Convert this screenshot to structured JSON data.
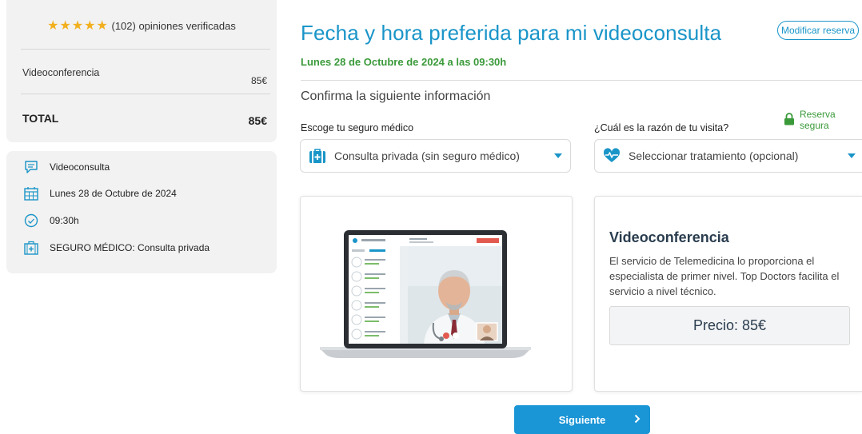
{
  "summary": {
    "rating_stars": "★★★★★",
    "rating_text": "(102) opiniones verificadas",
    "line_item_label": "Videoconferencia",
    "line_item_price": "85€",
    "total_label": "TOTAL",
    "total_price": "85€"
  },
  "details": {
    "items": [
      {
        "icon": "chat-icon",
        "label": "Videoconsulta"
      },
      {
        "icon": "calendar-icon",
        "label": "Lunes 28 de Octubre de 2024"
      },
      {
        "icon": "clock-icon",
        "label": "09:30h"
      },
      {
        "icon": "medical-case-icon",
        "label": "SEGURO MÉDICO: Consulta privada"
      }
    ]
  },
  "header": {
    "title": "Fecha y hora preferida para mi videoconsulta",
    "modify_label": "Modificar reserva",
    "selected_date": "Lunes 28 de Octubre de 2024 a las 09:30h"
  },
  "form": {
    "confirm_title": "Confirma la siguiente información",
    "secure_label": "Reserva segura",
    "insurance_label": "Escoge tu seguro médico",
    "insurance_value": "Consulta privada (sin seguro médico)",
    "reason_label": "¿Cuál es la razón de tu visita?",
    "reason_value": "Seleccionar tratamiento (opcional)"
  },
  "info_panel": {
    "title": "Videoconferencia",
    "description": "El servicio de Telemedicina lo proporciona el especialista de primer nivel. Top Doctors facilita el servicio a nivel técnico.",
    "price": "Precio: 85€"
  },
  "actions": {
    "next_label": "Siguiente"
  },
  "colors": {
    "accent": "#1a95c8",
    "success": "#3a9a3a",
    "star": "#f2b01e"
  }
}
